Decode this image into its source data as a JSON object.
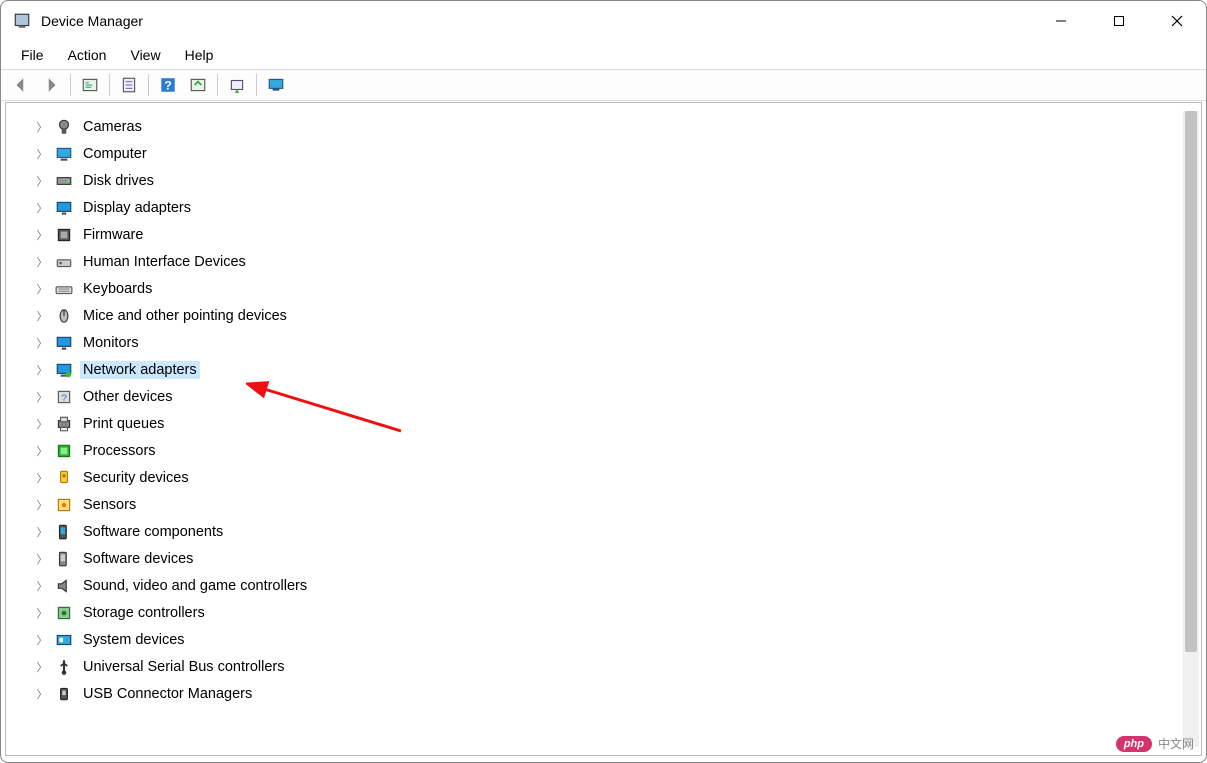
{
  "window": {
    "title": "Device Manager"
  },
  "menus": [
    "File",
    "Action",
    "View",
    "Help"
  ],
  "toolbar": [
    {
      "name": "back-icon"
    },
    {
      "name": "forward-icon"
    },
    {
      "sep": true
    },
    {
      "name": "show-hidden-icon"
    },
    {
      "sep": true
    },
    {
      "name": "properties-icon"
    },
    {
      "sep": true
    },
    {
      "name": "help-icon"
    },
    {
      "name": "scan-icon"
    },
    {
      "sep": true
    },
    {
      "name": "update-driver-icon"
    },
    {
      "sep": true
    },
    {
      "name": "display-icon"
    }
  ],
  "devices": [
    {
      "label": "Cameras",
      "icon": "camera-icon",
      "selected": false
    },
    {
      "label": "Computer",
      "icon": "computer-icon",
      "selected": false
    },
    {
      "label": "Disk drives",
      "icon": "disk-icon",
      "selected": false
    },
    {
      "label": "Display adapters",
      "icon": "display-icon",
      "selected": false
    },
    {
      "label": "Firmware",
      "icon": "chip-icon",
      "selected": false
    },
    {
      "label": "Human Interface Devices",
      "icon": "hid-icon",
      "selected": false
    },
    {
      "label": "Keyboards",
      "icon": "keyboard-icon",
      "selected": false
    },
    {
      "label": "Mice and other pointing devices",
      "icon": "mouse-icon",
      "selected": false
    },
    {
      "label": "Monitors",
      "icon": "monitor-icon",
      "selected": false
    },
    {
      "label": "Network adapters",
      "icon": "network-icon",
      "selected": true
    },
    {
      "label": "Other devices",
      "icon": "other-icon",
      "selected": false
    },
    {
      "label": "Print queues",
      "icon": "printer-icon",
      "selected": false
    },
    {
      "label": "Processors",
      "icon": "cpu-icon",
      "selected": false
    },
    {
      "label": "Security devices",
      "icon": "security-icon",
      "selected": false
    },
    {
      "label": "Sensors",
      "icon": "sensor-icon",
      "selected": false
    },
    {
      "label": "Software components",
      "icon": "software-icon",
      "selected": false
    },
    {
      "label": "Software devices",
      "icon": "swdev-icon",
      "selected": false
    },
    {
      "label": "Sound, video and game controllers",
      "icon": "sound-icon",
      "selected": false
    },
    {
      "label": "Storage controllers",
      "icon": "storage-icon",
      "selected": false
    },
    {
      "label": "System devices",
      "icon": "system-icon",
      "selected": false
    },
    {
      "label": "Universal Serial Bus controllers",
      "icon": "usb-icon",
      "selected": false
    },
    {
      "label": "USB Connector Managers",
      "icon": "usbconn-icon",
      "selected": false
    }
  ],
  "watermark": {
    "badge": "php",
    "text": "中文网"
  }
}
